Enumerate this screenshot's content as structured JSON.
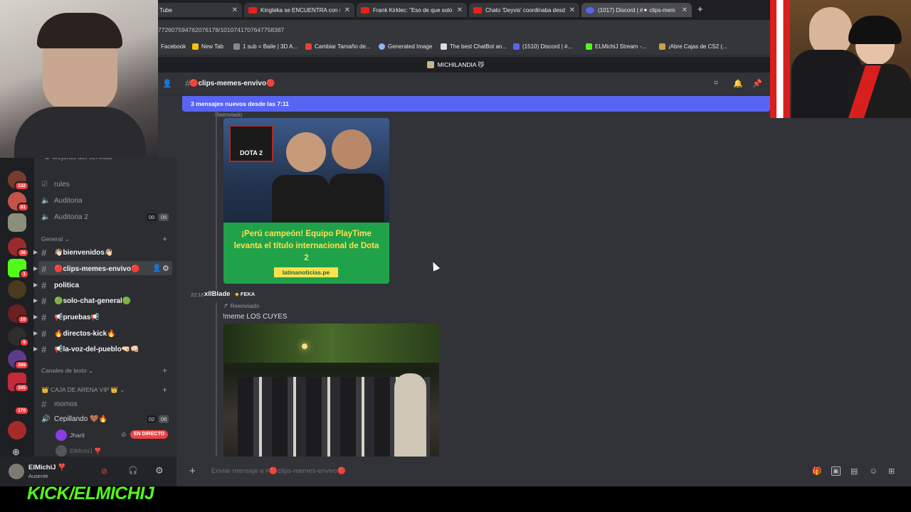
{
  "browser": {
    "tabs": [
      {
        "label": "Tube",
        "active": false
      },
      {
        "label": "Kingteka se ENCUENTRA con s",
        "active": false
      },
      {
        "label": "Frank Kirklec: \"Eso de que solo u",
        "active": false
      },
      {
        "label": "Chato 'Deyvis' coordinaba desd",
        "active": false
      },
      {
        "label": "(1017) Discord | #⚫ clips-mem",
        "active": true
      }
    ],
    "url": "772607594762076178/1010741707647758387",
    "bookmarks": [
      "Facebook",
      "New Tab",
      "1 sub = Baile | 3D A...",
      "Cambiar Tamaño de...",
      "Generated Image",
      "The best ChatBot an...",
      "(1510) Discord | #...",
      "ELMichiJ Stream -...",
      "¡Abre Cajas de CS2 (..."
    ]
  },
  "server": {
    "name": "MICHILANDIA 😼"
  },
  "channel": {
    "name": "clips-memes-envivo",
    "new_messages_banner": "3 mensajes nuevos desde las 7:11",
    "input_placeholder": "Enviar mensaje a #🔴clips-memes-envivo🔴"
  },
  "server_badges": [
    "132",
    "81",
    "36",
    "1",
    "10",
    "6",
    "399",
    "105",
    "170"
  ],
  "sidebar": {
    "boost_label": "Mejoras del servidor",
    "top_channels": [
      {
        "label": "rules",
        "type": "text"
      },
      {
        "label": "Auditoria",
        "type": "voice"
      },
      {
        "label": "Auditoria 2",
        "type": "voice",
        "count_a": "00",
        "count_b": "05"
      }
    ],
    "category_general": "General",
    "general_channels": [
      "👋🏻bienvenidos👋🏻",
      "🔴clips-memes-envivo🔴",
      "politica",
      "🟢solo-chat-general🟢",
      "📢pruebas📢",
      "🔥directos-kick🔥",
      "📢la-voz-del-pueblo🤜🏻👊🏻"
    ],
    "category_text": "Canales de texto",
    "category_vip": "👑 CAJA DE ARENA VIP 👑",
    "vip_channels": [
      {
        "label": "momos",
        "type": "text"
      },
      {
        "label": "Cepillando 🤎🔥",
        "type": "voice",
        "count_a": "02",
        "count_b": "06"
      }
    ],
    "voice_users": [
      {
        "name": "Jharit",
        "badge": "EN DIRECTO"
      },
      {
        "name": "ElMichiJ ❣️"
      }
    ]
  },
  "user": {
    "name": "ElMichiJ ❣️",
    "status": "Ausente"
  },
  "messages": [
    {
      "forward_label": "Reenviado",
      "image_caption": "¡Perú campeón! Equipo PlayTime levanta el título internacional de Dota 2",
      "image_source": "latinanoticias.pe",
      "game_logo": "DOTA 2"
    },
    {
      "time": "22:16",
      "author": "xllBlade",
      "role_badge": "FEKA",
      "forward_label": "Reenviado",
      "text": "!meme LOS CUYES"
    }
  ],
  "overlay": {
    "kick_text": "KICK/ELMICHIJ"
  },
  "colors": {
    "blurple": "#5865f2",
    "kick_green": "#53fc18",
    "live_red": "#ed4245"
  }
}
